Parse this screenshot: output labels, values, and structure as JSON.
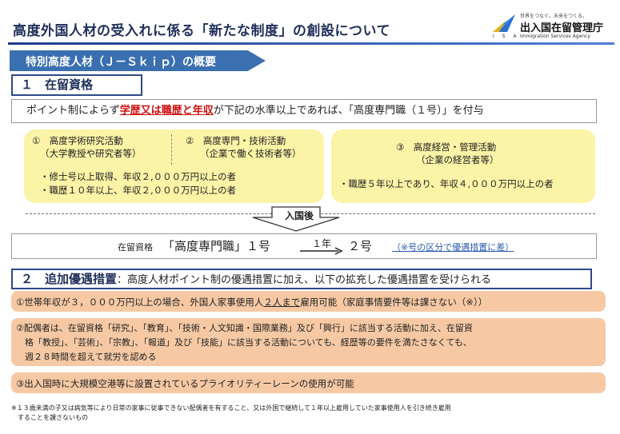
{
  "header": {
    "title": "高度外国人材の受入れに係る「新たな制度」の創設について",
    "logo_tagline": "世界をつなぐ。未来をつくる。",
    "logo_name": "出入国在留管理庁",
    "logo_en": "Immigration Services Agency",
    "logo_isa": "I S A"
  },
  "ribbon": {
    "label": "特別高度人材（Ｊ－Ｓｋｉｐ）の概要"
  },
  "section1": {
    "heading": "１　在留資格",
    "points_pre": "ポイント制によらず",
    "points_red": "学歴又は職歴と年収",
    "points_post": "が下記の水準以上であれば、「高度専門職（１号）」を付与",
    "cat1_title": "①　高度学術研究活動",
    "cat1_sub": "（大学教授や研究者等）",
    "cat2_title": "②　高度専門・技術活動",
    "cat2_sub": "（企業で働く技術者等）",
    "req12_a": "・修士号以上取得、年収２,０００万円以上の者",
    "req12_b": "・職歴１０年以上、年収２,０００万円以上の者",
    "cat3_title": "③　高度経営・管理活動",
    "cat3_sub": "（企業の経営者等）",
    "req3": "・職歴５年以上であり、年収４,０００万円以上の者",
    "arrow_label": "入国後",
    "status_prefix": "在留資格",
    "status_name": "「高度専門職」１号",
    "status_years": "１年",
    "status_next": "２号",
    "status_note": "（※号の区分で優遇措置に差）"
  },
  "section2": {
    "heading": "２　追加優遇措置",
    "heading_desc": "：高度人材ポイント制の優遇措置に加え、以下の拡充した優遇措置を受けられる",
    "item1_pre": "①世帯年収が３，０００万円以上の場合、外国人家事使用人",
    "item1_ul": "２人まで",
    "item1_post": "雇用可能（家庭事情要件等は課さない（※））",
    "item2_l1": "②配偶者は、在留資格「研究」、「教育」、「技術・人文知識・国際業務」及び「興行」に該当する活動に加え、在留資",
    "item2_l2": "格「教授」、「芸術」、「宗教」、「報道」及び「技能」に該当する活動についても、経歴等の要件を満たさなくても、",
    "item2_l3": "週２８時間を超えて就労を認める",
    "item3": "③出入国時に大規模空港等に設置されているプライオリティーレーンの使用が可能"
  },
  "footnote": {
    "line1": "※１３歳未満の子又は病気等により日常の家事に従事できない配偶者を有すること、又は外国で継続して１年以上雇用していた家事使用人を引き続き雇用",
    "line2": "することを課さないもの"
  },
  "colors": {
    "navy": "#1f2f5a",
    "ribbon": "#3a6fb0",
    "yellow": "#fbf3a6",
    "peach": "#f6c9a4",
    "red": "#d01010"
  }
}
